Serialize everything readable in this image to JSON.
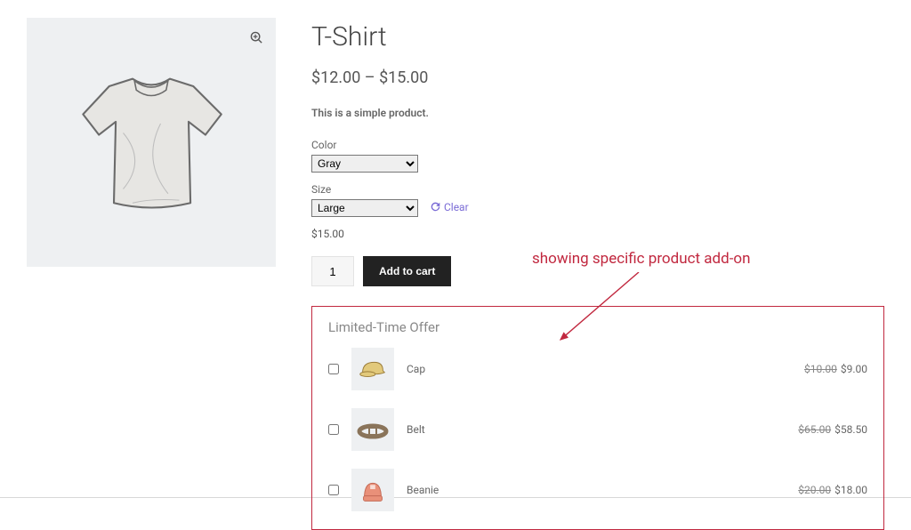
{
  "product": {
    "title": "T-Shirt",
    "price_range": "$12.00 – $15.00",
    "short_description": "This is a simple product.",
    "variations": {
      "color": {
        "label": "Color",
        "selected": "Gray"
      },
      "size": {
        "label": "Size",
        "selected": "Large"
      }
    },
    "clear_text": "Clear",
    "variation_price": "$15.00",
    "quantity": "1",
    "add_to_cart_label": "Add to cart"
  },
  "offer": {
    "heading": "Limited-Time Offer",
    "items": [
      {
        "name": "Cap",
        "old_price": "$10.00",
        "new_price": "$9.00",
        "color": "#e2c97b"
      },
      {
        "name": "Belt",
        "old_price": "$65.00",
        "new_price": "$58.50",
        "color": "#c9b49a"
      },
      {
        "name": "Beanie",
        "old_price": "$20.00",
        "new_price": "$18.00",
        "color": "#e99079"
      }
    ]
  },
  "annotation": {
    "text": "showing specific product add-on"
  }
}
